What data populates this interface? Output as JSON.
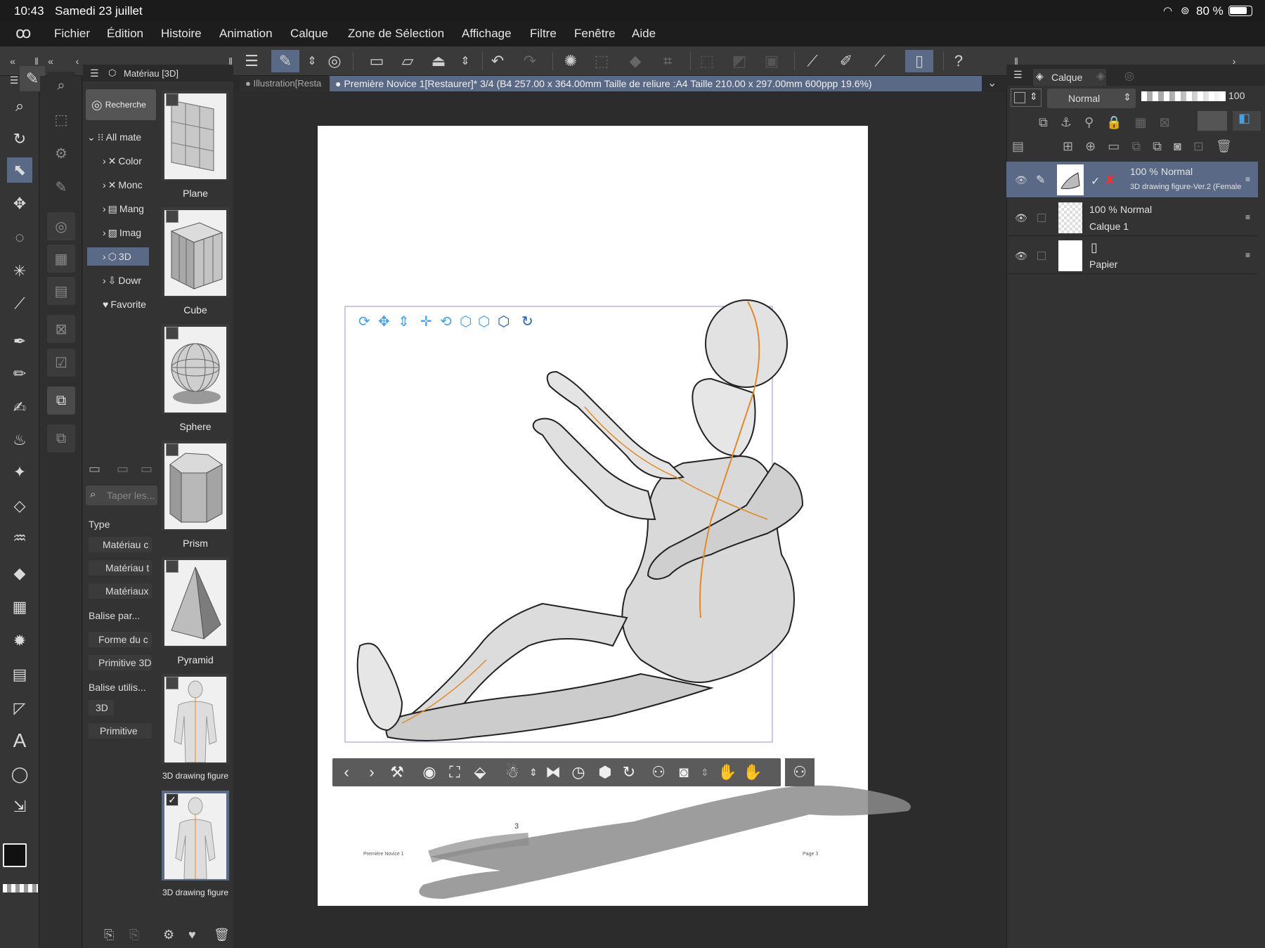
{
  "status": {
    "time": "10:43",
    "date": "Samedi 23 juillet",
    "battery": "80 %"
  },
  "menu": [
    "Fichier",
    "Édition",
    "Histoire",
    "Animation",
    "Calque",
    "Zone de Sélection",
    "Affichage",
    "Filtre",
    "Fenêtre",
    "Aide"
  ],
  "material_panel": {
    "title": "Matériau [3D]",
    "search_button": "Rechercher",
    "tree": [
      "All mate",
      "Color",
      "Monc",
      "Mang",
      "Imag",
      "3D",
      "Dowr",
      "Favorite"
    ],
    "search_placeholder": "Taper les...",
    "type_label": "Type",
    "type_tags": [
      "Matériau c",
      "Matériau t",
      "Matériaux"
    ],
    "balise_label": "Balise par...",
    "balise_tags": [
      "Forme du c",
      "Primitive 3D"
    ],
    "user_label": "Balise utilis...",
    "user_tags": [
      "3D",
      "Primitive"
    ],
    "thumbs": [
      "Plane",
      "Cube",
      "Sphere",
      "Prism",
      "Pyramid",
      "3D drawing figure",
      "3D drawing figure"
    ],
    "checked_mark": "✓"
  },
  "tabs": {
    "tab1": "Illustration[Resta",
    "tab2": "Première Novice 1[Restaurer]* 3/4 (B4 257.00 x 364.00mm Taille de reliure :A4 Taille 210.00 x 297.00mm 600ppp 19.6%)"
  },
  "page": {
    "number": "3",
    "footer_left": "Première Novice 1",
    "footer_right": "Page 3"
  },
  "layer_panel": {
    "title": "Calque",
    "blend": "Normal",
    "opacity": "100",
    "layers": [
      {
        "opacity": "100 %",
        "blend": "Normal",
        "name": "3D drawing figure-Ver.2 (Female"
      },
      {
        "opacity": "100 %",
        "blend": "Normal",
        "name": "Calque 1"
      },
      {
        "name": "Papier"
      }
    ]
  },
  "colors": {
    "accent": "#5a6a86",
    "handle_blue": "#4a9fe0",
    "orange_line": "#e08a2a"
  }
}
